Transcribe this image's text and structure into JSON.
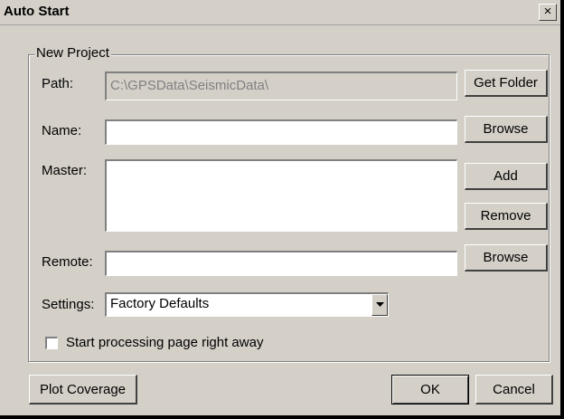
{
  "window": {
    "title": "Auto Start",
    "close_glyph": "×"
  },
  "new_project": {
    "legend": "New Project",
    "path": {
      "label": "Path:",
      "value": "C:\\GPSData\\SeismicData\\",
      "button": "Get Folder"
    },
    "name": {
      "label": "Name:",
      "value": "",
      "button": "Browse"
    },
    "master": {
      "label": "Master:",
      "value": "",
      "add_button": "Add",
      "remove_button": "Remove"
    },
    "remote": {
      "label": "Remote:",
      "value": "",
      "button": "Browse"
    },
    "settings": {
      "label": "Settings:",
      "selected": "Factory Defaults"
    },
    "start_processing": {
      "label": "Start processing page right away",
      "checked": false
    }
  },
  "footer": {
    "plot_coverage": "Plot Coverage",
    "ok": "OK",
    "cancel": "Cancel"
  }
}
